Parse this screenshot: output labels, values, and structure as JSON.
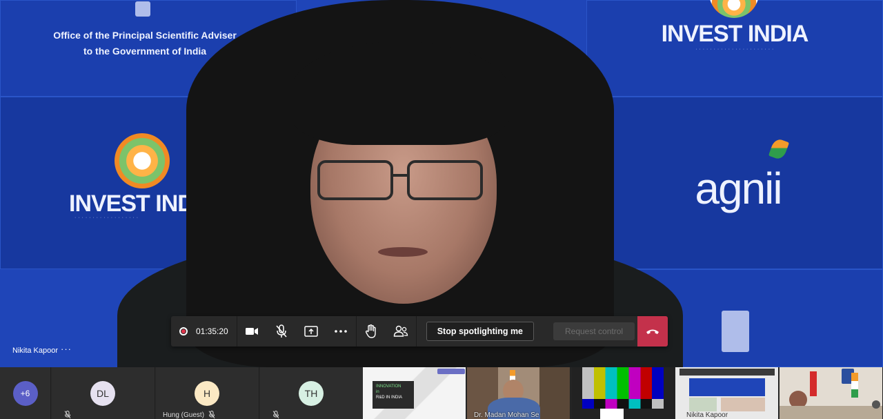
{
  "meeting": {
    "speaker": {
      "name": "Nikita Kapoor",
      "more": "···"
    },
    "timer": "01:35:20",
    "buttons": {
      "camera": "Turn camera off",
      "mic": "Unmute",
      "share": "Share content",
      "more": "More actions",
      "raise_hand": "Raise your hand",
      "participants": "Show participants",
      "stop_spotlight": "Stop spotlighting me",
      "request_control": "Request control",
      "leave": "Leave"
    },
    "colors": {
      "accent": "#5b5fc7",
      "hangup": "#c4314b",
      "recording": "#e0354c",
      "backdrop": "#1f45b8"
    }
  },
  "backdrop": {
    "left_top_line1": "Office of the Principal Scientific Adviser",
    "left_top_line2": "to the Government of India",
    "invest_india_right": "INVEST INDIA",
    "invest_india_left": "INVEST INDI",
    "agnii": "agnii"
  },
  "gallery": {
    "overflow_count": "+6",
    "participants": [
      {
        "initials": "DL",
        "name": "",
        "color": "#e6e1f0"
      },
      {
        "initials": "H",
        "name": "Hung (Guest)",
        "color": "#fbe9c4"
      },
      {
        "initials": "TH",
        "name": "",
        "color": "#d7f0e3"
      }
    ],
    "video_tiles": [
      {
        "name": "",
        "slide_line1": "INNOVATION",
        "slide_line2": "in",
        "slide_line3": "R&D IN INDIA"
      },
      {
        "name": "Dr. Madan Mohan Se"
      },
      {
        "name": ""
      },
      {
        "name": "Nikita Kapoor"
      },
      {
        "name": ""
      }
    ]
  }
}
